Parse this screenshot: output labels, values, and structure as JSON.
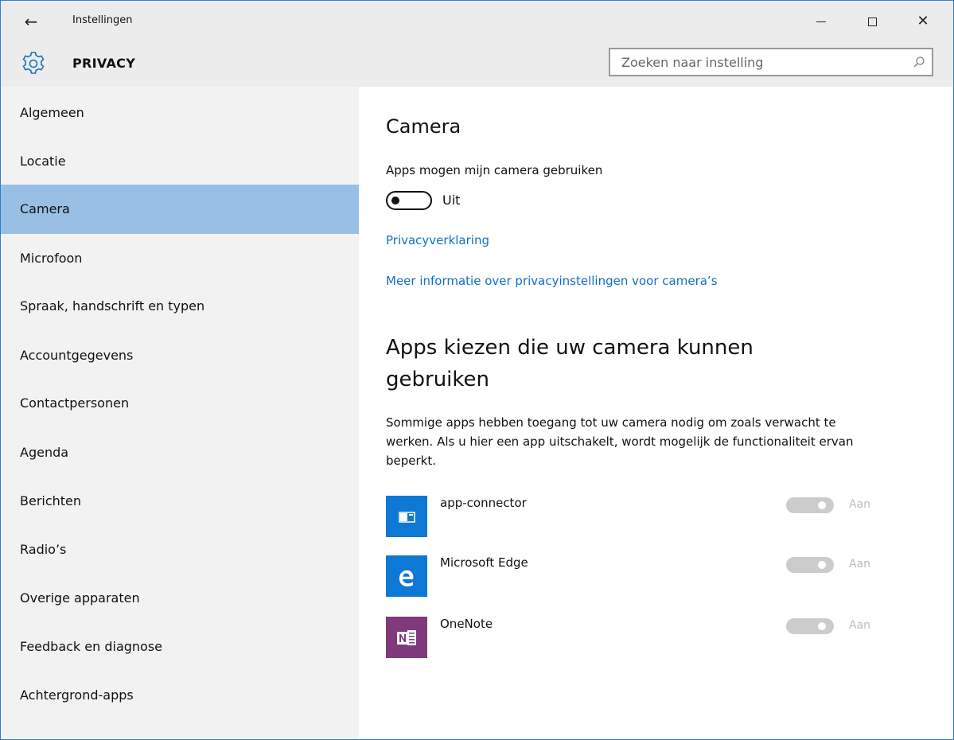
{
  "window": {
    "title": "Instellingen",
    "back_icon": "arrow-left-icon",
    "minimize_icon": "minimize-icon",
    "maximize_icon": "maximize-icon",
    "close_icon": "close-icon",
    "close_glyph": "✕",
    "back_glyph": "←"
  },
  "header": {
    "icon": "gear-icon",
    "title": "PRIVACY",
    "search_placeholder": "Zoeken naar instelling",
    "search_icon": "search-icon"
  },
  "sidebar": {
    "items": [
      {
        "label": "Algemeen"
      },
      {
        "label": "Locatie"
      },
      {
        "label": "Camera",
        "active": true
      },
      {
        "label": "Microfoon"
      },
      {
        "label": "Spraak, handschrift en typen"
      },
      {
        "label": "Accountgegevens"
      },
      {
        "label": "Contactpersonen"
      },
      {
        "label": "Agenda"
      },
      {
        "label": "Berichten"
      },
      {
        "label": "Radio’s"
      },
      {
        "label": "Overige apparaten"
      },
      {
        "label": "Feedback en diagnose"
      },
      {
        "label": "Achtergrond-apps"
      }
    ]
  },
  "main": {
    "title": "Camera",
    "camera_toggle_label": "Apps mogen mijn camera gebruiken",
    "camera_toggle_state": "Uit",
    "camera_toggle_on": false,
    "privacy_link": "Privacyverklaring",
    "more_info_link": "Meer informatie over privacyinstellingen voor camera’s",
    "apps_heading": "Apps kiezen die uw camera kunnen gebruiken",
    "apps_description": "Sommige apps hebben toegang tot uw camera nodig om zoals verwacht te werken. Als u hier een app uitschakelt, wordt mogelijk de functionaliteit ervan beperkt.",
    "apps": [
      {
        "name": "app-connector",
        "state": "Aan",
        "icon": "app-connector-icon",
        "icon_color": "#0e78d5",
        "enabled": false
      },
      {
        "name": "Microsoft Edge",
        "state": "Aan",
        "icon": "edge-icon",
        "icon_color": "#0e78d5",
        "enabled": false
      },
      {
        "name": "OneNote",
        "state": "Aan",
        "icon": "onenote-icon",
        "icon_color": "#80397b",
        "enabled": false
      }
    ]
  },
  "colors": {
    "accent": "#99c0e4",
    "link": "#0f6fc6",
    "window_border": "#2b7fd4",
    "toggle_disabled": "#cccccc"
  }
}
